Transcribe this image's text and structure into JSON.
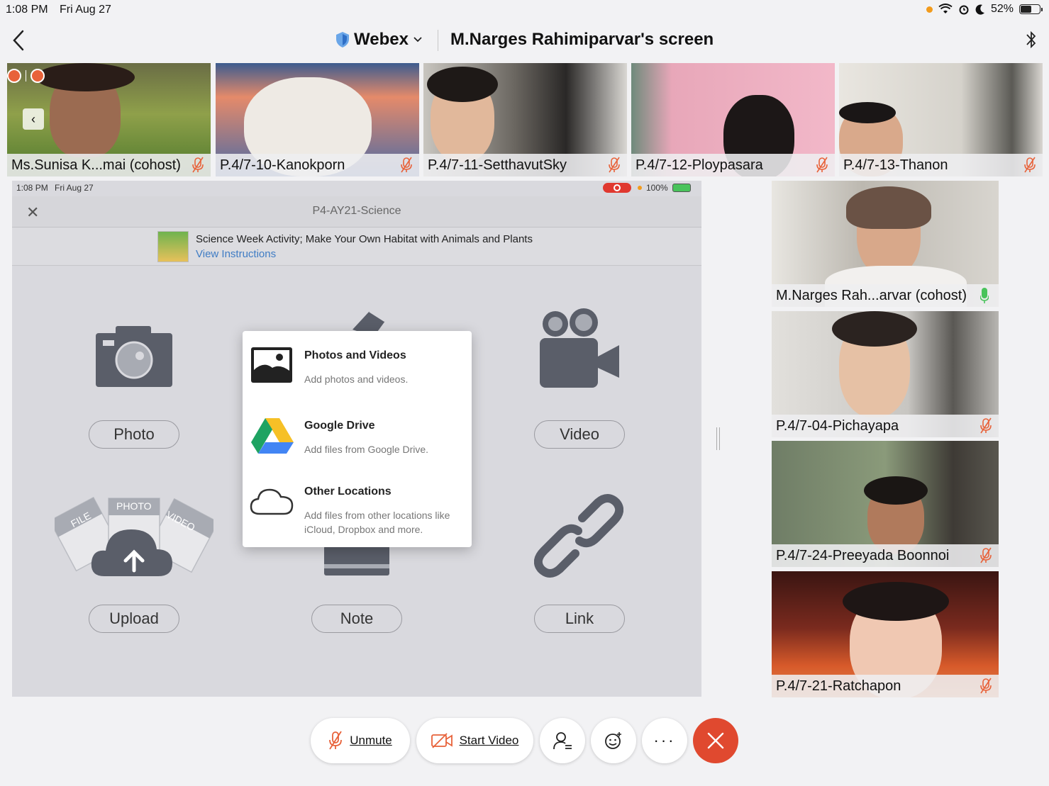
{
  "status_bar": {
    "time": "1:08 PM",
    "date": "Fri Aug 27",
    "battery": "52%",
    "battery_level": 0.52
  },
  "header": {
    "app_name": "Webex",
    "screen_title": "M.Narges Rahimiparvar's screen"
  },
  "participants_strip": [
    {
      "name": "Ms.Sunisa K...mai (cohost)"
    },
    {
      "name": "P.4/7-10-Kanokporn"
    },
    {
      "name": "P.4/7-11-SetthavutSky"
    },
    {
      "name": "P.4/7-12-Ploypasara"
    },
    {
      "name": "P.4/7-13-Thanon"
    }
  ],
  "shared_screen": {
    "status": {
      "time": "1:08 PM",
      "date": "Fri Aug 27",
      "battery": "100%"
    },
    "title": "P4-AY21-Science",
    "banner": {
      "title": "Science Week Activity; Make Your Own Habitat with Animals and Plants",
      "link": "View Instructions"
    },
    "options": {
      "photo": "Photo",
      "video": "Video",
      "upload": "Upload",
      "note": "Note",
      "link": "Link"
    },
    "upload_tags": {
      "file": "FILE",
      "photo": "PHOTO",
      "video": "VIDEO"
    },
    "popup": [
      {
        "title": "Photos and Videos",
        "subtitle": "Add photos and videos."
      },
      {
        "title": "Google Drive",
        "subtitle": "Add files from Google Drive."
      },
      {
        "title": "Other Locations",
        "subtitle": "Add files from other locations like iCloud, Dropbox and more."
      }
    ]
  },
  "participants_column": [
    {
      "name": "M.Narges Rah...arvar (cohost)"
    },
    {
      "name": "P.4/7-04-Pichayapa"
    },
    {
      "name": "P.4/7-24-Preeyada Boonnoi"
    },
    {
      "name": "P.4/7-21-Ratchapon"
    }
  ],
  "toolbar": {
    "unmute": "Unmute",
    "start_video": "Start Video"
  },
  "colors": {
    "leave": "#e0492f",
    "link": "#3f7cc4",
    "mic_on": "#49c35b",
    "mic_off": "#e8623a"
  }
}
